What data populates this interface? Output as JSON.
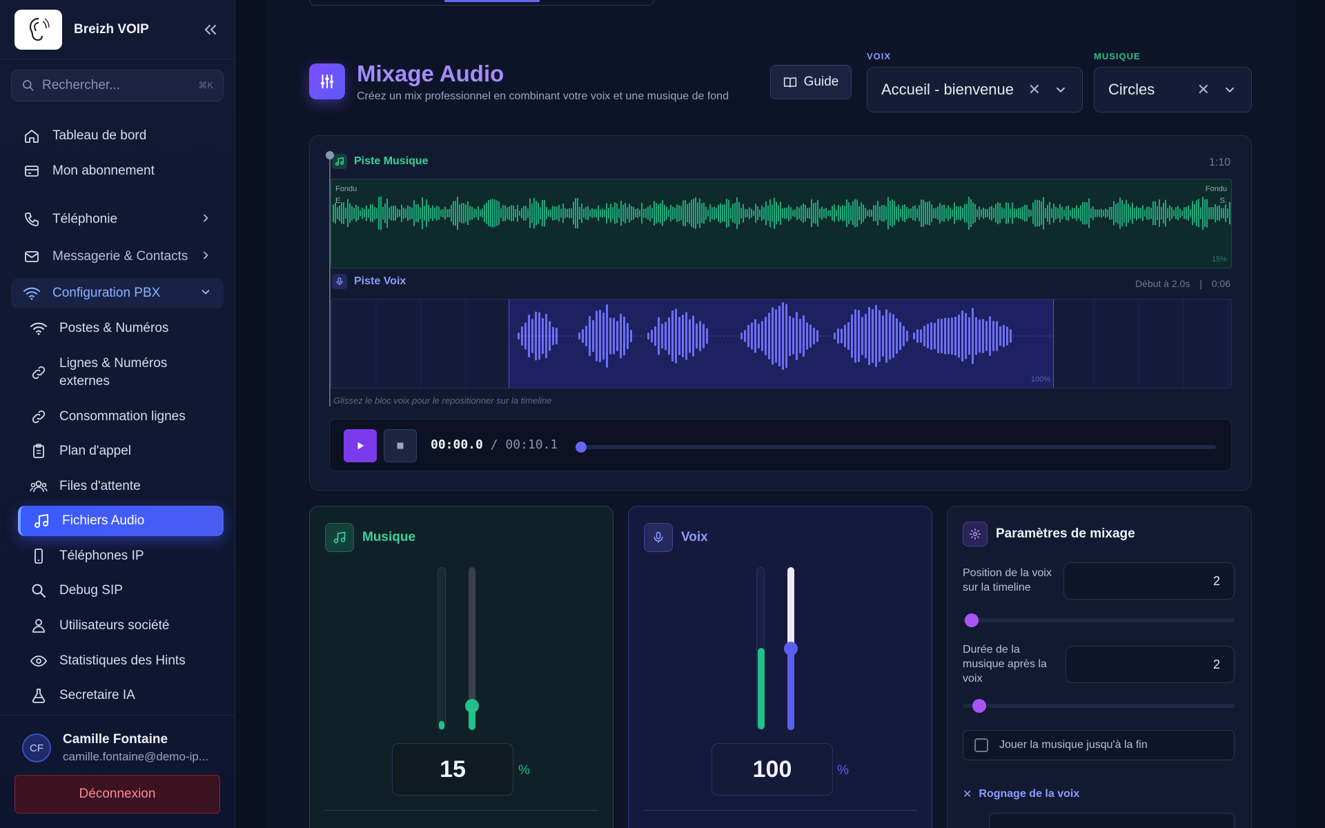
{
  "sidebar": {
    "brand": "Breizh VOIP",
    "search_placeholder": "Rechercher...",
    "search_shortcut": "⌘K",
    "items": [
      {
        "label": "Tableau de bord"
      },
      {
        "label": "Mon abonnement"
      },
      {
        "label": "Téléphonie"
      },
      {
        "label": "Messagerie & Contacts"
      },
      {
        "label": "Configuration PBX"
      },
      {
        "label": "Postes & Numéros"
      },
      {
        "label": "Lignes & Numéros externes"
      },
      {
        "label": "Consommation lignes"
      },
      {
        "label": "Plan d'appel"
      },
      {
        "label": "Files d'attente"
      },
      {
        "label": "Fichiers Audio"
      },
      {
        "label": "Téléphones IP"
      },
      {
        "label": "Debug SIP"
      },
      {
        "label": "Utilisateurs société"
      },
      {
        "label": "Statistiques des Hints"
      },
      {
        "label": "Secretaire IA"
      }
    ],
    "user": {
      "initials": "CF",
      "name": "Camille Fontaine",
      "email": "camille.fontaine@demo-ip..."
    },
    "logout_label": "Déconnexion"
  },
  "header": {
    "title": "Mixage Audio",
    "subtitle": "Créez un mix professionnel en combinant votre voix et une musique de fond",
    "guide_label": "Guide",
    "voice_label": "VOIX",
    "voice_value": "Accueil - bienvenue",
    "music_label": "MUSIQUE",
    "music_value": "Circles"
  },
  "timeline": {
    "music_track": {
      "label": "Piste Musique",
      "duration": "1:10",
      "fade_in": "Fondu E.",
      "fade_out": "Fondu S.",
      "volume_tag": "15%"
    },
    "voice_track": {
      "label": "Piste Voix",
      "start": "Début à 2.0s",
      "divider": "|",
      "duration": "0:06",
      "volume_tag": "100%"
    },
    "hint": "Glissez le bloc voix pour le repositionner sur la timeline",
    "player": {
      "current": "00:00.0",
      "separator": "/",
      "total": "00:10.1",
      "progress": 0
    }
  },
  "music_card": {
    "title": "Musique",
    "volume": "15",
    "unit": "%",
    "volume_fraction": 0.15,
    "meter_fraction": 0.02,
    "color": "#22c08a"
  },
  "voice_card": {
    "title": "Voix",
    "volume": "100",
    "unit": "%",
    "volume_fraction": 0.5,
    "meter_fraction": 0.5,
    "color": "#5b5ff0"
  },
  "params": {
    "title": "Paramètres de mixage",
    "position_label": "Position de la voix sur la timeline",
    "position_value": "2",
    "duration_label": "Durée de la musique après la voix",
    "duration_value": "2",
    "play_until_end_label": "Jouer la musique jusqu'à la fin",
    "trim_label": "Rognage de la voix"
  },
  "colors": {
    "accent": "#6366f1",
    "music": "#22c08a",
    "voice": "#5b5ff0",
    "title": "#a58cff"
  }
}
